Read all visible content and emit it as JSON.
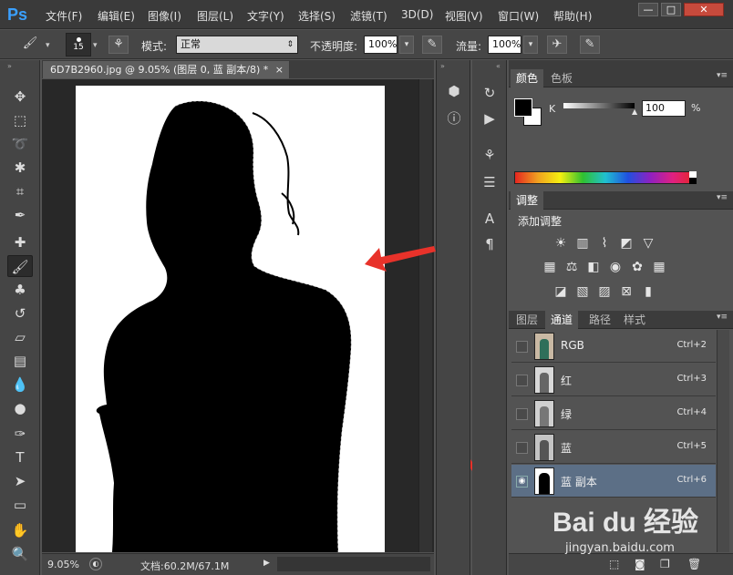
{
  "app": {
    "logo": "Ps"
  },
  "menu": [
    "文件(F)",
    "编辑(E)",
    "图像(I)",
    "图层(L)",
    "文字(Y)",
    "选择(S)",
    "滤镜(T)",
    "3D(D)",
    "视图(V)",
    "窗口(W)",
    "帮助(H)"
  ],
  "window_controls": {
    "minimize": "—",
    "restore": "□",
    "close": "✕"
  },
  "options": {
    "brush_size": "15",
    "mode_label": "模式:",
    "mode_value": "正常",
    "opacity_label": "不透明度:",
    "opacity_value": "100%",
    "flow_label": "流量:",
    "flow_value": "100%"
  },
  "document": {
    "tab_title": "6D7B2960.jpg @ 9.05% (图层 0, 蓝 副本/8) *",
    "close": "×",
    "zoom": "9.05%",
    "doc_info": "文档:60.2M/67.1M"
  },
  "color_panel": {
    "tabs": [
      "颜色",
      "色板"
    ],
    "channel_label": "K",
    "value": "100",
    "unit": "%",
    "foreground": "#000000",
    "background": "#ffffff"
  },
  "adjustments_panel": {
    "tab": "调整",
    "title": "添加调整"
  },
  "channels_panel": {
    "tabs": [
      "图层",
      "通道",
      "路径",
      "样式"
    ],
    "active_tab": "通道",
    "rows": [
      {
        "name": "RGB",
        "shortcut": "Ctrl+2",
        "visible": false,
        "selected": false
      },
      {
        "name": "红",
        "shortcut": "Ctrl+3",
        "visible": false,
        "selected": false
      },
      {
        "name": "绿",
        "shortcut": "Ctrl+4",
        "visible": false,
        "selected": false
      },
      {
        "name": "蓝",
        "shortcut": "Ctrl+5",
        "visible": false,
        "selected": false
      },
      {
        "name": "蓝 副本",
        "shortcut": "Ctrl+6",
        "visible": true,
        "selected": true
      }
    ]
  },
  "watermark": {
    "logo": "Bai du 经验",
    "url": "jingyan.baidu.com"
  },
  "colors": {
    "arrow": "#e8322a",
    "selected_row": "#5c6f86",
    "accent": "#3aa0ff"
  }
}
